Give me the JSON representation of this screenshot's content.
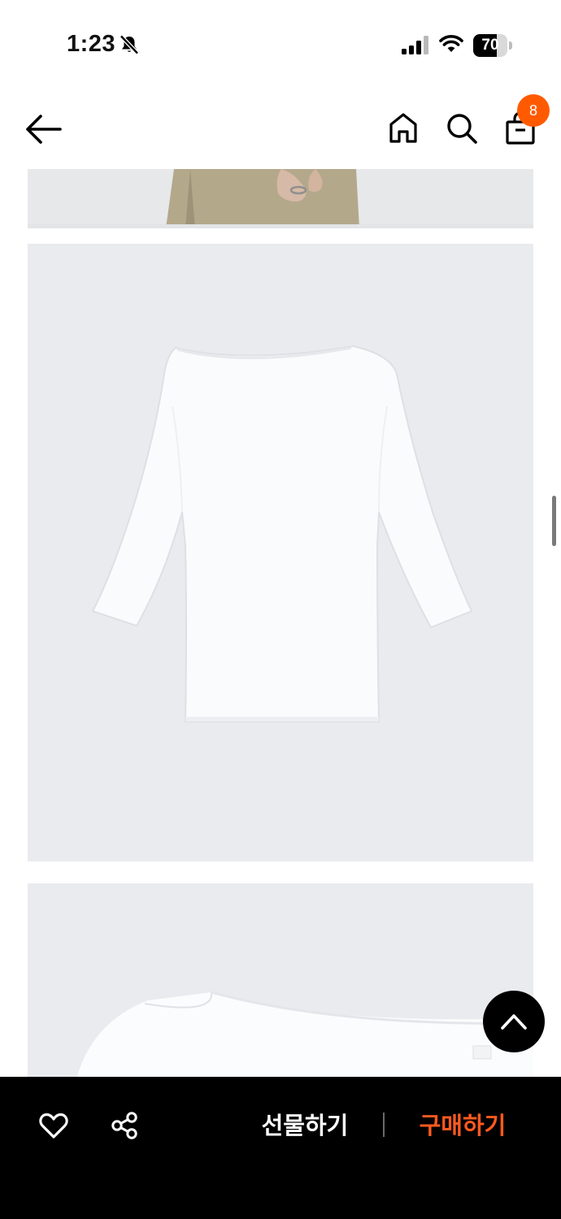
{
  "status_bar": {
    "time": "1:23",
    "battery_level": "70",
    "battery_fraction": 0.7,
    "icons": [
      "bell-slash-icon",
      "cellular-signal-icon",
      "wifi-icon",
      "battery-icon"
    ]
  },
  "header": {
    "icons": [
      "back-arrow-icon",
      "home-icon",
      "search-icon",
      "shopping-bag-icon"
    ],
    "cart_count": "8"
  },
  "bottom_bar": {
    "gift_label": "선물하기",
    "buy_label": "구매하기",
    "icons": [
      "heart-icon",
      "share-icon",
      "chevron-up-icon"
    ]
  },
  "colors": {
    "accent": "#ff5a00",
    "bottom_bar_bg": "#000000",
    "image_bg": "#e9ebee"
  }
}
